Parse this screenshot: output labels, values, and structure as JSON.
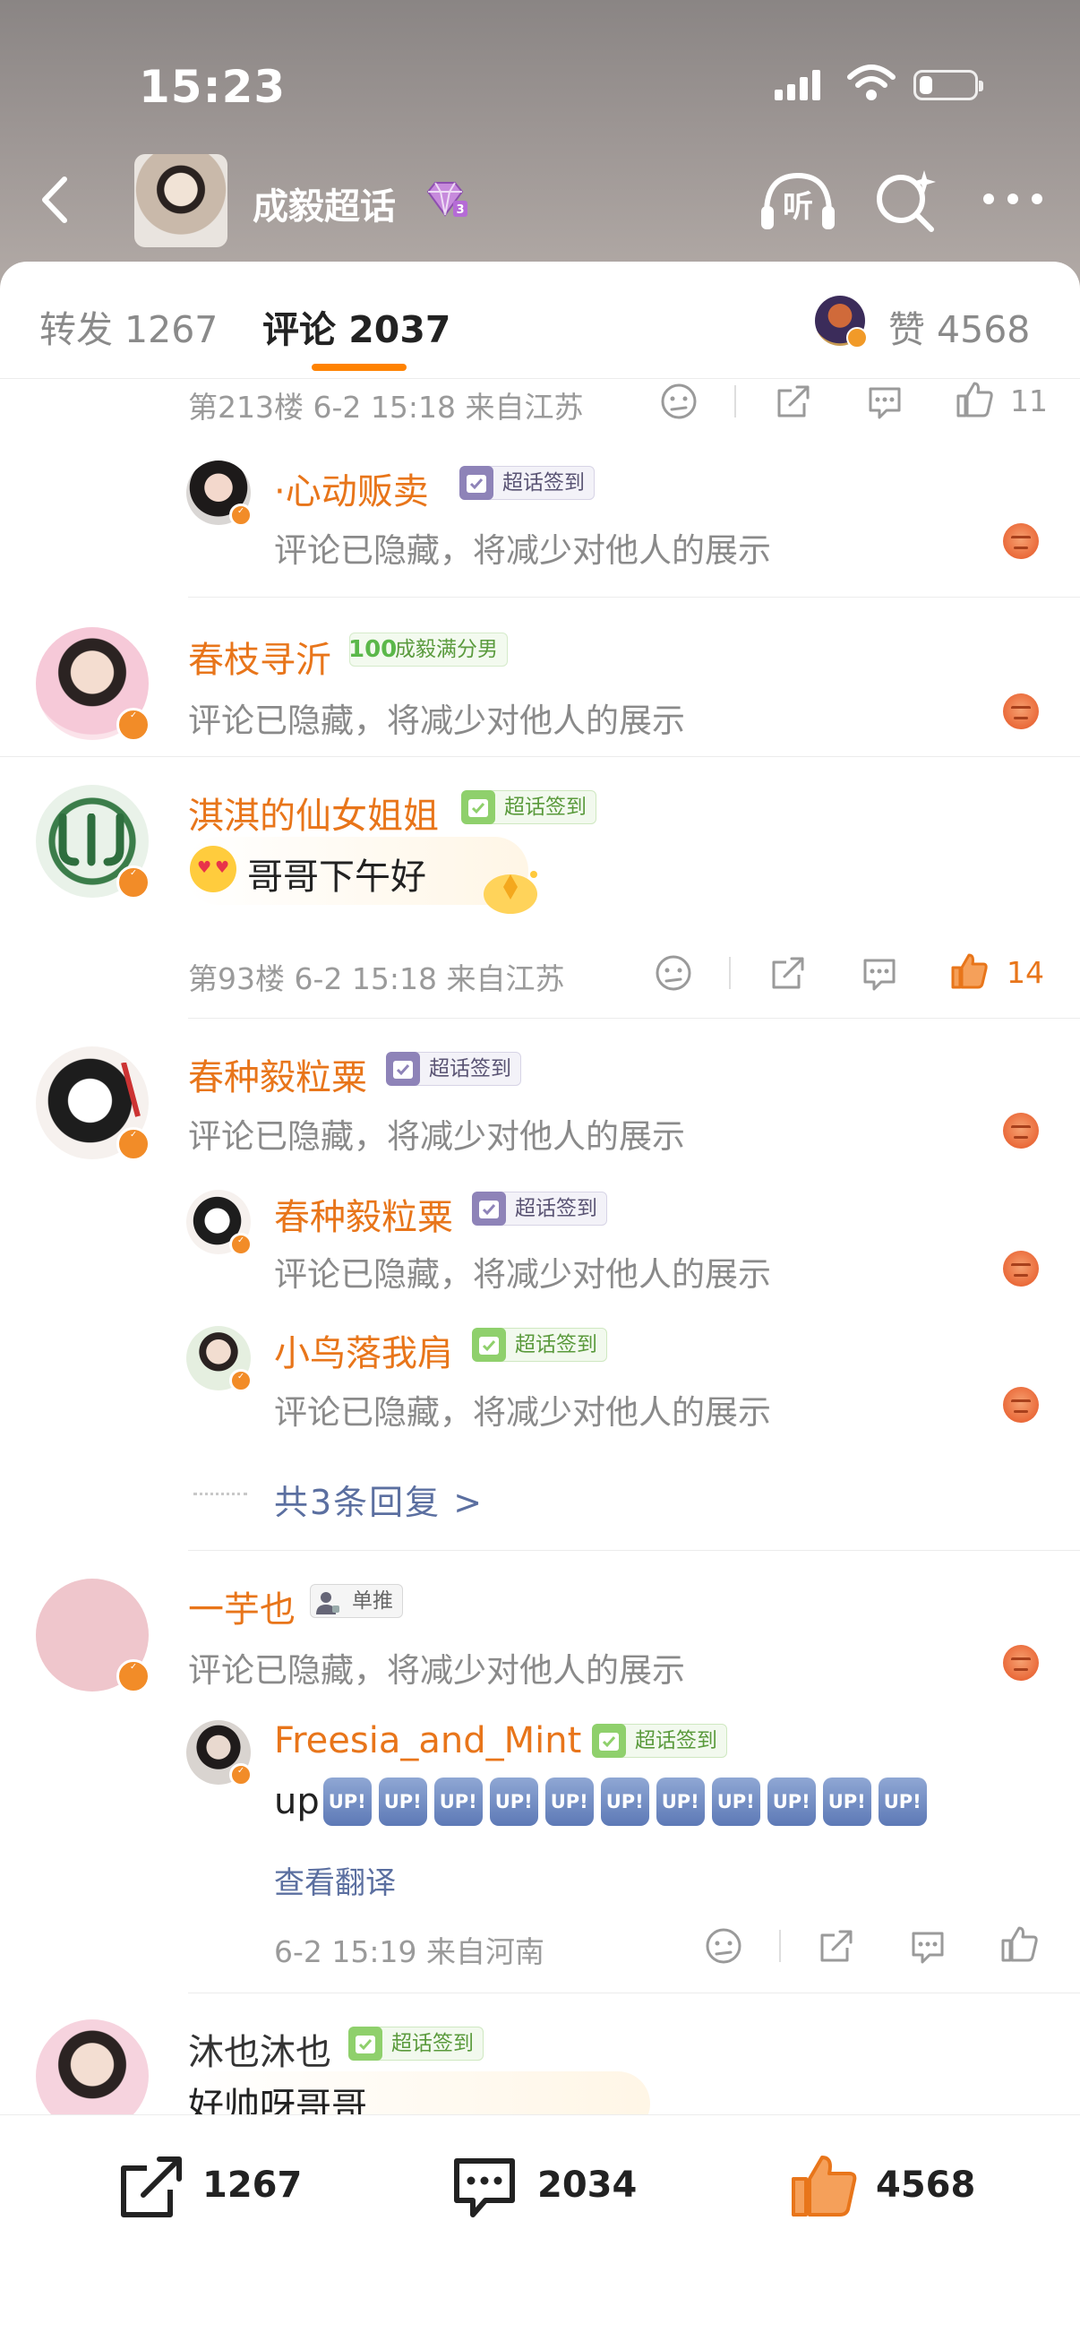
{
  "status_bar": {
    "time": "15:23"
  },
  "header": {
    "title": "成毅超话"
  },
  "tabs": {
    "repost": "转发 1267",
    "comments": "评论 2037",
    "likes": "赞 4568"
  },
  "comments": [
    {
      "meta": "第213楼 6-2 15:18 来自江苏",
      "like_count": "11",
      "replies": [
        {
          "nickname": "·心动贩卖",
          "badge": "超话签到",
          "text": "评论已隐藏，将减少对他人的展示"
        }
      ]
    },
    {
      "nickname": "春枝寻沂",
      "badge": "成毅满分男",
      "text": "评论已隐藏，将减少对他人的展示"
    },
    {
      "nickname": "淇淇的仙女姐姐",
      "badge": "超话签到",
      "text": "哥哥下午好",
      "meta": "第93楼 6-2 15:18 来自江苏",
      "like_count": "14"
    },
    {
      "nickname": "春种毅粒粟",
      "badge": "超话签到",
      "text": "评论已隐藏，将减少对他人的展示",
      "replies": [
        {
          "nickname": "春种毅粒粟",
          "badge": "超话签到",
          "text": "评论已隐藏，将减少对他人的展示"
        },
        {
          "nickname": "小鸟落我肩",
          "badge": "超话签到",
          "text": "评论已隐藏，将减少对他人的展示"
        }
      ],
      "more_replies": "共3条回复 >"
    },
    {
      "nickname": "一芋也",
      "badge": "单推",
      "text": "评论已隐藏，将减少对他人的展示",
      "replies": [
        {
          "nickname": "Freesia_and_Mint",
          "badge": "超话签到",
          "text_prefix": "up",
          "stickers": [
            "UP!",
            "UP!",
            "UP!",
            "UP!",
            "UP!",
            "UP!",
            "UP!",
            "UP!",
            "UP!",
            "UP!",
            "UP!"
          ],
          "translate": "查看翻译",
          "meta": "6-2 15:19 来自河南"
        }
      ]
    },
    {
      "nickname": "沐也沐也",
      "badge": "超话签到",
      "text": "好帅呀哥哥"
    }
  ],
  "bottom_bar": {
    "repost_count": "1267",
    "comment_count": "2034",
    "like_count": "4568"
  },
  "colors": {
    "accent": "#ff8200",
    "nickname": "#e8751a",
    "link": "#5b6fa0"
  },
  "icons": [
    "back-icon",
    "gem-icon",
    "listen-icon",
    "ai-search-icon",
    "more-icon",
    "dislike-icon",
    "share-icon",
    "comment-icon",
    "like-icon",
    "angry-emoji-icon"
  ]
}
